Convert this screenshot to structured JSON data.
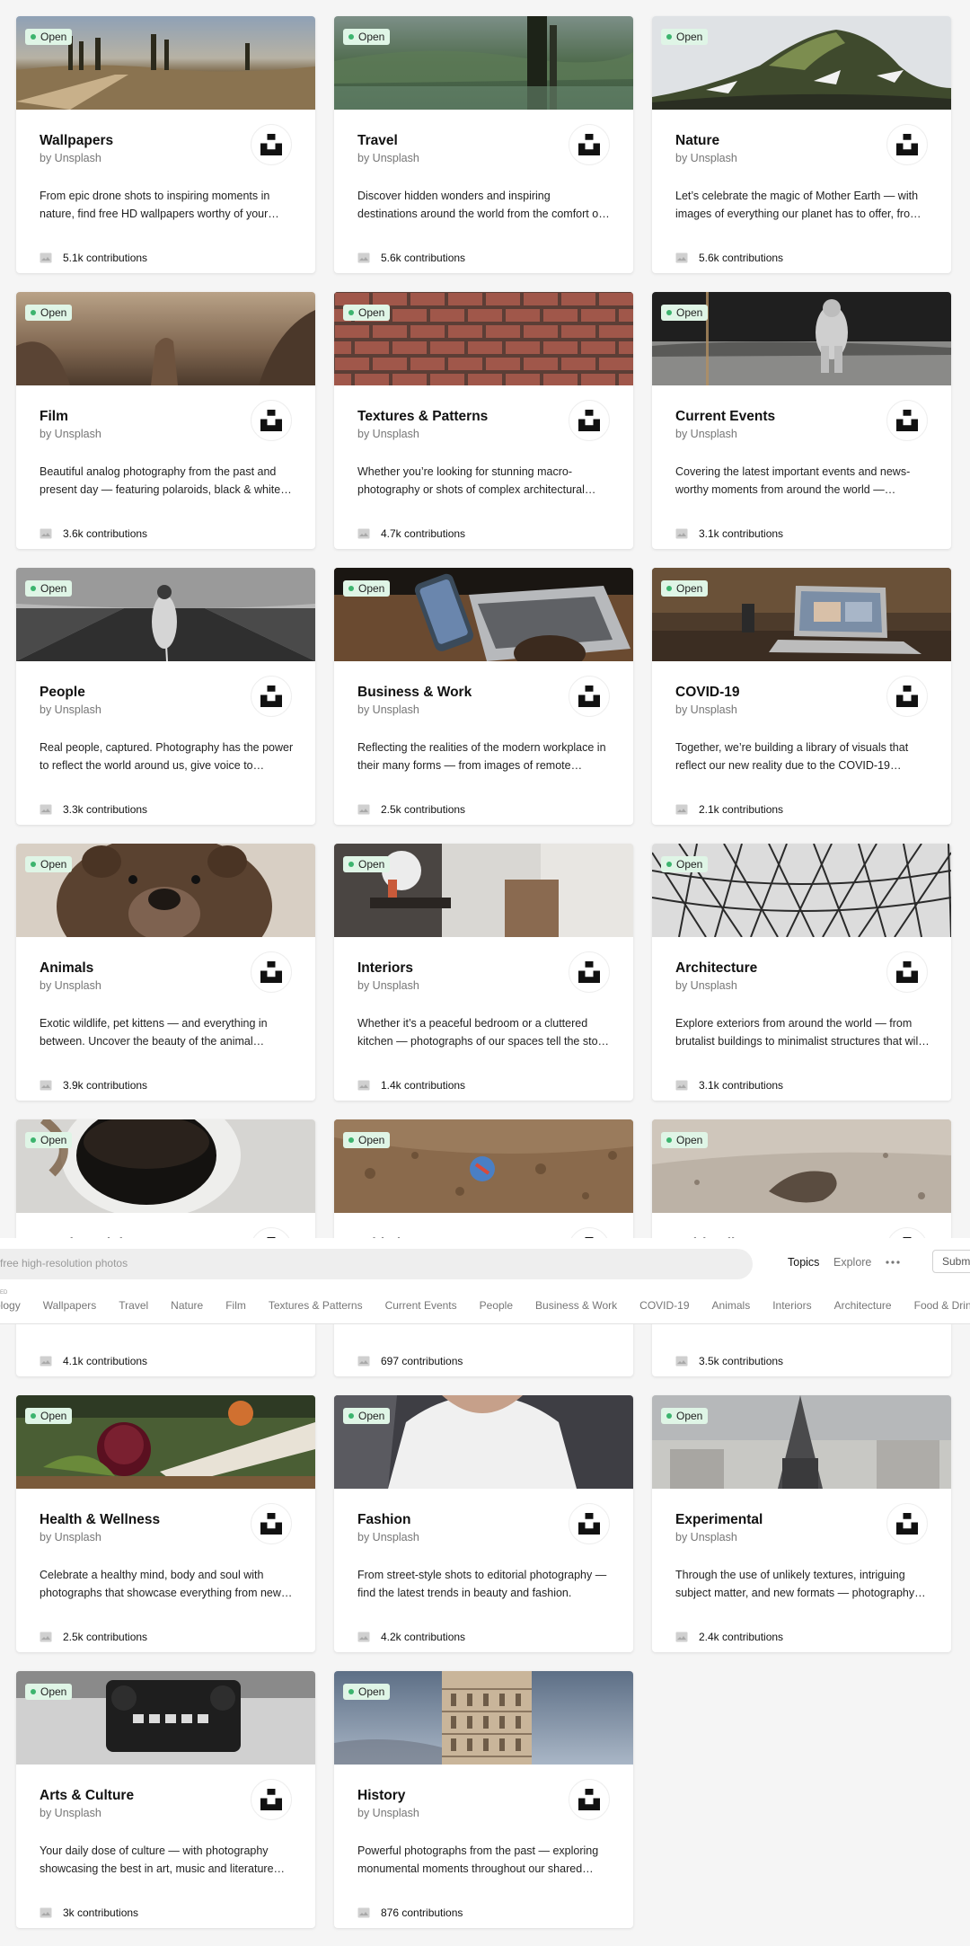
{
  "badge_label": "Open",
  "byline": "by Unsplash",
  "contributions_suffix": "contributions",
  "cards": [
    {
      "title": "Wallpapers",
      "desc": "From epic drone shots to inspiring moments in nature, find free HD wallpapers worthy of your mobile and desktop screens.",
      "count": "5.1k contributions",
      "cover": "wallpapers"
    },
    {
      "title": "Travel",
      "desc": "Discover hidden wonders and inspiring destinations around the world from the comfort of your own home.",
      "count": "5.6k contributions",
      "cover": "travel"
    },
    {
      "title": "Nature",
      "desc": "Let’s celebrate the magic of Mother Earth — with images of everything our planet has to offer, from stunning seascapes to starry skies.",
      "count": "5.6k contributions",
      "cover": "nature"
    },
    {
      "title": "Film",
      "desc": "Beautiful analog photography from the past and present day — featuring polaroids, black & white film and more.",
      "count": "3.6k contributions",
      "cover": "film"
    },
    {
      "title": "Textures & Patterns",
      "desc": "Whether you’re looking for stunning macro-photography or shots of complex architectural shapes and forms.",
      "count": "4.7k contributions",
      "cover": "textures"
    },
    {
      "title": "Current Events",
      "desc": "Covering the latest important events and news-worthy moments from around the world — including climate action and more.",
      "count": "3.1k contributions",
      "cover": "current"
    },
    {
      "title": "People",
      "desc": "Real people, captured. Photography has the power to reflect the world around us, give voice to individuals and groups.",
      "count": "3.3k contributions",
      "cover": "people"
    },
    {
      "title": "Business & Work",
      "desc": "Reflecting the realities of the modern workplace in their many forms — from images of remote working and more.",
      "count": "2.5k contributions",
      "cover": "business"
    },
    {
      "title": "COVID-19",
      "desc": "Together, we’re building a library of visuals that reflect our new reality due to the COVID-19 pandemic — and more.",
      "count": "2.1k contributions",
      "cover": "covid"
    },
    {
      "title": "Animals",
      "desc": "Exotic wildlife, pet kittens — and everything in between. Uncover the beauty of the animal kingdom through your lens.",
      "count": "3.9k contributions",
      "cover": "animals"
    },
    {
      "title": "Interiors",
      "desc": "Whether it’s a peaceful bedroom or a cluttered kitchen — photographs of our spaces tell the story of who we are.",
      "count": "1.4k contributions",
      "cover": "interiors"
    },
    {
      "title": "Architecture",
      "desc": "Explore exteriors from around the world — from brutalist buildings to minimalist structures that will give you inspiration.",
      "count": "3.1k contributions",
      "cover": "architecture"
    },
    {
      "title": "Food & Drink",
      "desc": "",
      "count": "4.1k contributions",
      "cover": "food"
    },
    {
      "title": "Athletics",
      "desc": "",
      "count": "697 contributions",
      "cover": "athletics"
    },
    {
      "title": "Spirituality",
      "desc": "",
      "count": "3.5k contributions",
      "cover": "spirituality"
    },
    {
      "title": "Health & Wellness",
      "desc": "Celebrate a healthy mind, body and soul with photographs that showcase everything from new recipes to yoga poses.",
      "count": "2.5k contributions",
      "cover": "health"
    },
    {
      "title": "Fashion",
      "desc": "From street-style shots to editorial photography — find the latest trends in beauty and fashion.",
      "count": "4.2k contributions",
      "cover": "fashion"
    },
    {
      "title": "Experimental",
      "desc": "Through the use of unlikely textures, intriguing subject matter, and new formats — photography has the power to surprise.",
      "count": "2.4k contributions",
      "cover": "experimental"
    },
    {
      "title": "Arts & Culture",
      "desc": "Your daily dose of culture — with photography showcasing the best in art, music and literature from around the world.",
      "count": "3k contributions",
      "cover": "arts"
    },
    {
      "title": "History",
      "desc": "Powerful photographs from the past — exploring monumental moments throughout our shared history.",
      "count": "876 contributions",
      "cover": "history"
    }
  ],
  "header": {
    "search_placeholder": "free high-resolution photos",
    "nav_topics": "Topics",
    "nav_explore": "Explore",
    "submit_label": "Submit",
    "tiny_label": "ED",
    "topics": [
      "ology",
      "Wallpapers",
      "Travel",
      "Nature",
      "Film",
      "Textures & Patterns",
      "Current Events",
      "People",
      "Business & Work",
      "COVID-19",
      "Animals",
      "Interiors",
      "Architecture",
      "Food & Drink"
    ]
  },
  "colors": {
    "badge_bg": "#dff5e6",
    "badge_dot": "#3cb46e",
    "page_bg": "#f5f5f5"
  },
  "icons": {
    "logo": "unsplash-logo-icon",
    "contributions": "image-icon",
    "more": "more-dots-icon"
  }
}
